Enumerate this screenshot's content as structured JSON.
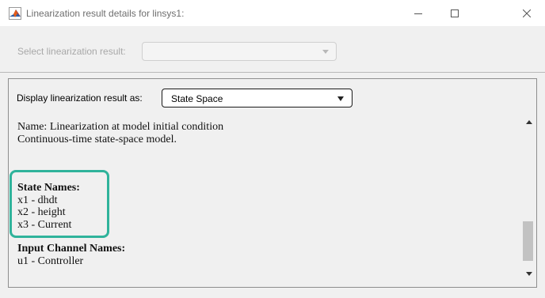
{
  "window": {
    "title": "Linearization result details for linsys1:"
  },
  "top": {
    "select_label": "Select linearization result:",
    "select_value": ""
  },
  "panel": {
    "display_label": "Display linearization result as:",
    "display_value": "State Space",
    "lines": {
      "name": "Name: Linearization at model initial condition",
      "model_type": "Continuous-time state-space model.",
      "state_names_header": "State Names:",
      "state_1": "x1 - dhdt",
      "state_2": "x2 - height",
      "state_3": "x3 - Current",
      "input_names_header": "Input Channel Names:",
      "input_1": "u1 - Controller"
    }
  },
  "colors": {
    "highlight": "#2fb39b"
  }
}
